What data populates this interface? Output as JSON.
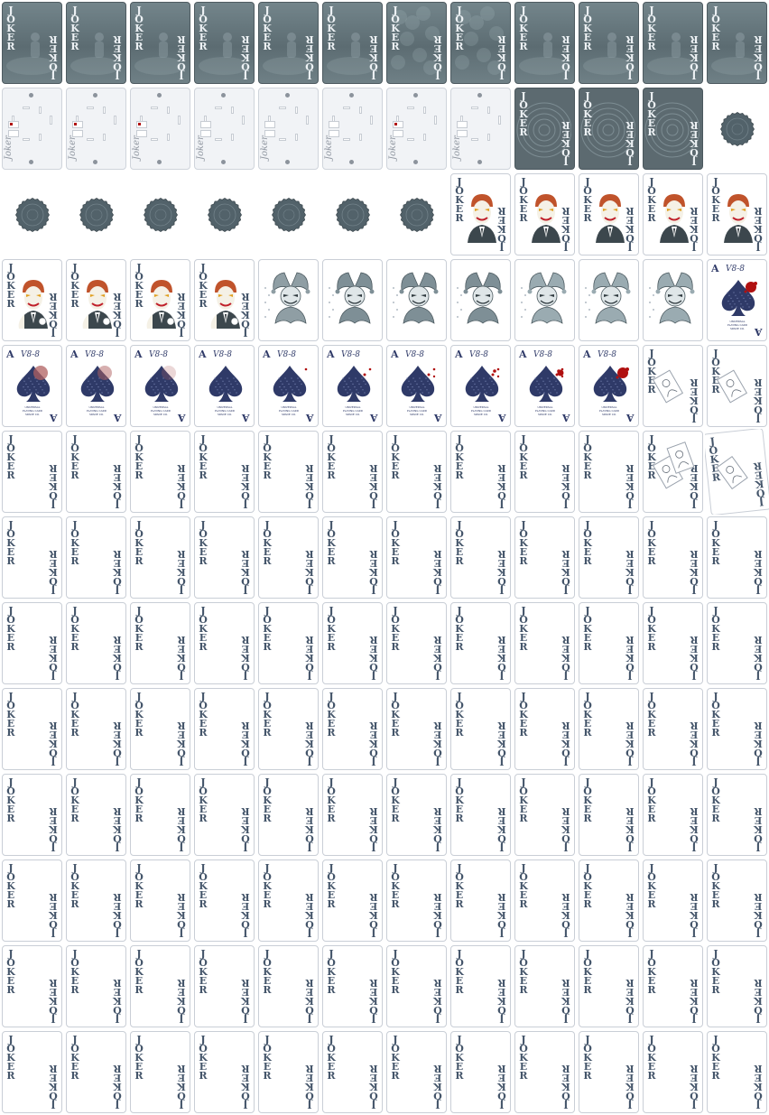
{
  "sheet": {
    "columns": 12,
    "rows": 13,
    "background": "#ffffff"
  },
  "colors": {
    "card_face": "#ffffff",
    "card_border": "#c9ced6",
    "back_dark": "#5c6a70",
    "joker_text": "#44556a",
    "spade_navy": "#2f3a68",
    "blood_red": "#b01010",
    "coin_grey": "#52626a"
  },
  "labels": {
    "joker_index": "JOKER",
    "joker_signature": "Joker",
    "ace_rank": "A",
    "ace_signature": "V8-8",
    "ace_print_lines": [
      "UNIVERSAL",
      "PLAYING CARD",
      "SPADE",
      "CO."
    ]
  },
  "frames": [
    {
      "kind": "back-fog"
    },
    {
      "kind": "back-fog"
    },
    {
      "kind": "back-fog"
    },
    {
      "kind": "back-fog"
    },
    {
      "kind": "back-fog"
    },
    {
      "kind": "back-fog"
    },
    {
      "kind": "back-swirl"
    },
    {
      "kind": "back-swirl"
    },
    {
      "kind": "back-fog"
    },
    {
      "kind": "back-fog"
    },
    {
      "kind": "back-fog"
    },
    {
      "kind": "back-fog"
    },
    {
      "kind": "panel",
      "stage": 0,
      "red": true
    },
    {
      "kind": "panel",
      "stage": 0,
      "red": true
    },
    {
      "kind": "panel",
      "stage": 0,
      "red": true
    },
    {
      "kind": "panel",
      "stage": 0,
      "red": false
    },
    {
      "kind": "panel",
      "stage": 0,
      "red": false
    },
    {
      "kind": "panel",
      "stage": 0,
      "red": false
    },
    {
      "kind": "panel",
      "stage": 0,
      "red": true
    },
    {
      "kind": "panel",
      "stage": 0,
      "red": false
    },
    {
      "kind": "back-ring"
    },
    {
      "kind": "back-ring"
    },
    {
      "kind": "back-ring"
    },
    {
      "kind": "coin"
    },
    {
      "kind": "coin"
    },
    {
      "kind": "coin"
    },
    {
      "kind": "coin"
    },
    {
      "kind": "coin"
    },
    {
      "kind": "coin"
    },
    {
      "kind": "coin"
    },
    {
      "kind": "coin"
    },
    {
      "kind": "joker-face",
      "pose": "a"
    },
    {
      "kind": "joker-face",
      "pose": "b"
    },
    {
      "kind": "joker-face",
      "pose": "a"
    },
    {
      "kind": "joker-face",
      "pose": "b"
    },
    {
      "kind": "joker-face",
      "pose": "a"
    },
    {
      "kind": "joker-face",
      "pose": "c"
    },
    {
      "kind": "joker-face",
      "pose": "c"
    },
    {
      "kind": "joker-face",
      "pose": "c"
    },
    {
      "kind": "joker-face",
      "pose": "c"
    },
    {
      "kind": "jester",
      "stage": 0
    },
    {
      "kind": "jester",
      "stage": 1
    },
    {
      "kind": "jester",
      "stage": 1
    },
    {
      "kind": "jester",
      "stage": 1
    },
    {
      "kind": "jester",
      "stage": 2
    },
    {
      "kind": "jester",
      "stage": 2
    },
    {
      "kind": "jester",
      "stage": 2
    },
    {
      "kind": "ace",
      "blood": "splat"
    },
    {
      "kind": "ace",
      "blood": "fade1"
    },
    {
      "kind": "ace",
      "blood": "fade2"
    },
    {
      "kind": "ace",
      "blood": "fade3"
    },
    {
      "kind": "ace",
      "blood": "none"
    },
    {
      "kind": "ace",
      "blood": "drop1"
    },
    {
      "kind": "ace",
      "blood": "drop2"
    },
    {
      "kind": "ace",
      "blood": "drop3"
    },
    {
      "kind": "ace",
      "blood": "drop4"
    },
    {
      "kind": "ace",
      "blood": "drop5"
    },
    {
      "kind": "ace",
      "blood": "splat"
    },
    {
      "kind": "joker-mini",
      "n": 1
    },
    {
      "kind": "joker-mini",
      "n": 1
    },
    {
      "kind": "joker"
    },
    {
      "kind": "joker"
    },
    {
      "kind": "joker"
    },
    {
      "kind": "joker"
    },
    {
      "kind": "joker"
    },
    {
      "kind": "joker"
    },
    {
      "kind": "joker"
    },
    {
      "kind": "joker"
    },
    {
      "kind": "joker"
    },
    {
      "kind": "joker"
    },
    {
      "kind": "joker-mini",
      "n": 2
    },
    {
      "kind": "joker-tilt"
    }
  ],
  "filler_kind": "joker"
}
